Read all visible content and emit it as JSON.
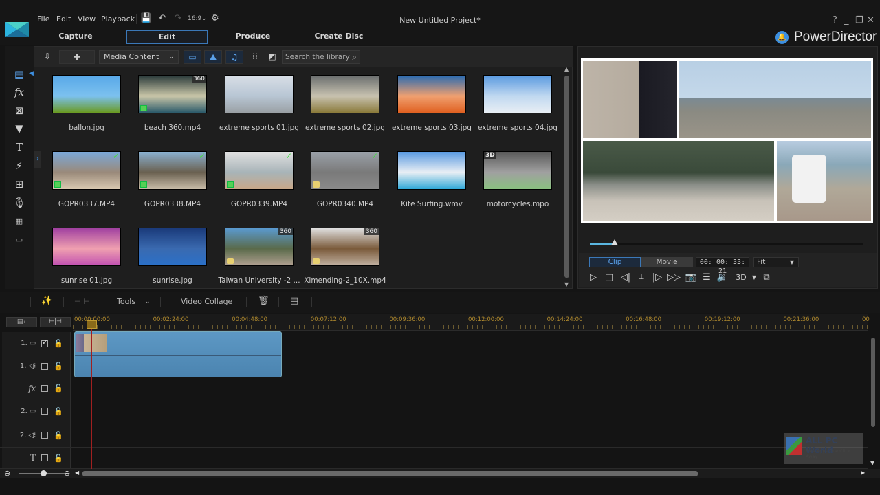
{
  "window": {
    "title": "New Untitled Project*",
    "brand": "PowerDirector",
    "controls": [
      "?",
      "_",
      "❐",
      "✕"
    ]
  },
  "menu": [
    "File",
    "Edit",
    "View",
    "Playback"
  ],
  "mode_tabs": [
    {
      "label": "Capture",
      "active": false
    },
    {
      "label": "Edit",
      "active": true
    },
    {
      "label": "Produce",
      "active": false
    },
    {
      "label": "Create Disc",
      "active": false
    }
  ],
  "library": {
    "content_select": "Media Content",
    "search_placeholder": "Search the library",
    "side_tools": [
      "media-room",
      "fx-room",
      "pip-room",
      "particle-room",
      "title-room",
      "transition-room",
      "audio-mixing-room",
      "voice-over-room",
      "chapter-room",
      "subtitle-room"
    ],
    "items": [
      {
        "name": "ballon.jpg",
        "type": "image",
        "badge": "",
        "checked": false,
        "colors": [
          "#58a8e8",
          "#7cc1ef",
          "#6a9a20"
        ]
      },
      {
        "name": "beach 360.mp4",
        "type": "video",
        "badge": "360",
        "checked": false,
        "colors": [
          "#2a3a3a",
          "#c9c6a8",
          "#2a5a6a"
        ]
      },
      {
        "name": "extreme sports 01.jpg",
        "type": "image",
        "badge": "",
        "checked": false,
        "colors": [
          "#d8dee6",
          "#b8c6d4",
          "#9aa0a4"
        ]
      },
      {
        "name": "extreme sports 02.jpg",
        "type": "image",
        "badge": "",
        "checked": false,
        "colors": [
          "#6a6e6e",
          "#c8c2b0",
          "#8a7a3a"
        ]
      },
      {
        "name": "extreme sports 03.jpg",
        "type": "image",
        "badge": "",
        "checked": false,
        "colors": [
          "#2a6ab0",
          "#f0a070",
          "#e06020"
        ]
      },
      {
        "name": "extreme sports 04.jpg",
        "type": "image",
        "badge": "",
        "checked": false,
        "colors": [
          "#5a9ae0",
          "#c0d8f0",
          "#e8eef4"
        ]
      },
      {
        "name": "GOPR0337.MP4",
        "type": "video",
        "badge": "",
        "checked": true,
        "colors": [
          "#7aa8d8",
          "#9a8a7a",
          "#d8c8b0"
        ]
      },
      {
        "name": "GOPR0338.MP4",
        "type": "video",
        "badge": "",
        "checked": true,
        "colors": [
          "#8ab0d0",
          "#6a6050",
          "#c8bca8"
        ]
      },
      {
        "name": "GOPR0339.MP4",
        "type": "video",
        "badge": "",
        "checked": true,
        "colors": [
          "#e0e0e0",
          "#a8b4b8",
          "#c8a888"
        ]
      },
      {
        "name": "GOPR0340.MP4",
        "type": "audio",
        "badge": "",
        "checked": true,
        "colors": [
          "#9aa0a8",
          "#7a7a7a",
          "#8a8a8a"
        ]
      },
      {
        "name": "Kite Surfing.wmv",
        "type": "image",
        "badge": "",
        "checked": false,
        "colors": [
          "#5a9ae0",
          "#e8eef4",
          "#30a8d8"
        ]
      },
      {
        "name": "motorcycles.mpo",
        "type": "image",
        "badge": "3D",
        "checked": false,
        "colors": [
          "#5a5a5a",
          "#a0a0a0",
          "#8ac080"
        ]
      },
      {
        "name": "sunrise 01.jpg",
        "type": "image",
        "badge": "",
        "checked": false,
        "colors": [
          "#a040a0",
          "#f0a0b0",
          "#c050b0"
        ]
      },
      {
        "name": "sunrise.jpg",
        "type": "image",
        "badge": "",
        "checked": false,
        "colors": [
          "#1a3a7a",
          "#3a6ab0",
          "#2a70c8"
        ]
      },
      {
        "name": "Taiwan University -2 ...",
        "type": "audio",
        "badge": "360",
        "checked": false,
        "colors": [
          "#5a9ad0",
          "#5a6a4a",
          "#b0a090"
        ]
      },
      {
        "name": "Ximending-2_10X.mp4",
        "type": "audio",
        "badge": "360",
        "checked": false,
        "colors": [
          "#e0e0e0",
          "#7a5a3a",
          "#c0b0a0"
        ]
      }
    ]
  },
  "preview": {
    "progress": 0.09,
    "modes": [
      {
        "label": "Clip",
        "active": true
      },
      {
        "label": "Movie",
        "active": false
      }
    ],
    "timecode": "00: 00: 33: 21",
    "zoom_select": "Fit",
    "three_d_label": "3D"
  },
  "timeline_toolbar": {
    "tools_label": "Tools",
    "video_collage_label": "Video Collage"
  },
  "ruler": {
    "ticks": [
      "00:00:00:00",
      "00:02:24:00",
      "00:04:48:00",
      "00:07:12:00",
      "00:09:36:00",
      "00:12:00:00",
      "00:14:24:00",
      "00:16:48:00",
      "00:19:12:00",
      "00:21:36:00",
      "00"
    ]
  },
  "tracks": [
    {
      "label": "1.",
      "kind": "video",
      "enabled": true
    },
    {
      "label": "1.",
      "kind": "audio",
      "enabled": false
    },
    {
      "label": "",
      "kind": "fx",
      "enabled": false
    },
    {
      "label": "2.",
      "kind": "video",
      "enabled": false
    },
    {
      "label": "2.",
      "kind": "audio",
      "enabled": false
    },
    {
      "label": "",
      "kind": "title",
      "enabled": false
    }
  ],
  "watermark": {
    "title": "ALL PC World",
    "subtitle": "Free Apps One Click Away"
  }
}
